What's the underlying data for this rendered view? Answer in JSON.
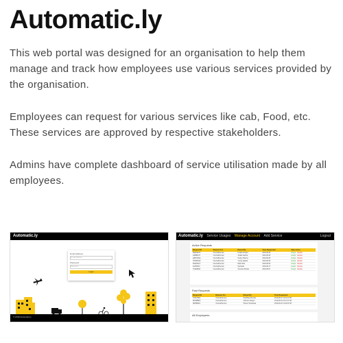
{
  "title": "Automatic.ly",
  "paragraphs": [
    "This web portal was designed for an organisation to help them manage and track how employees use various services provided by the organisation.",
    "Employees can request for various services like cab, Food, etc. These services are approved by respective stakeholders.",
    "Admins have complete dashboard of service utilisation made by all employees."
  ],
  "thumb_login": {
    "brand": "Automatic.ly",
    "email_label": "Email address",
    "email_placeholder": "E-mail address",
    "password_label": "Password",
    "password_placeholder": "Password",
    "login_button": "Login",
    "footer_text": "© 2018 Automatic.ly",
    "colors": {
      "accent": "#f5c518",
      "bar": "#000000"
    }
  },
  "thumb_dashboard": {
    "brand": "Automatic.ly",
    "nav": [
      "Service Usages",
      "Manage Account",
      "Add Service"
    ],
    "logout": "Logout",
    "active_requests_title": "Active Requests",
    "past_requests_title": "Past Requests",
    "all_employees_title": "All Employees",
    "active_headers": [
      "Request ID",
      "Request For",
      "Raised By",
      "Time Requested",
      "Take action"
    ],
    "active_rows": [
      [
        "3B2D4E7F",
        "OneCabService",
        "Krutika Prasad",
        "2019-08-26",
        "Accept",
        "Decline"
      ],
      [
        "a45B0C7F",
        "OneCabService",
        "Jinaba Kantha",
        "2019-08-26",
        "Accept",
        "Decline"
      ],
      [
        "a2BCD7Ea",
        "OneCabService",
        "Sudoy Sharma",
        "2019-08-05",
        "Accept",
        "Decline"
      ],
      [
        "7D29FE1E",
        "OneCabService",
        "Yuvraj Jaiswal",
        "2019-08-05",
        "Accept",
        "Decline"
      ],
      [
        "5DA8F0e3",
        "OneCabService",
        "Rahul Das",
        "2019-08-05",
        "Accept",
        "Decline"
      ],
      [
        "42A6F8c0",
        "OneCabService",
        "Sai Datta",
        "2019-08-17",
        "Accept",
        "Decline"
      ],
      [
        "7C4E8F8d",
        "OneCabService",
        "Virendra Shukla",
        "2019-08-07",
        "Accept",
        "Decline"
      ]
    ],
    "past_headers": [
      "Request ID",
      "Request For",
      "Raised By",
      "Time Requested"
    ],
    "past_rows": [
      [
        "7C5A79D4",
        "OneCabService",
        "Parthibaa Khenka",
        "2019-08-07 14:01:24 IST"
      ],
      [
        "5E7B8BF8",
        "OneCabService",
        "Abhinav Sangen",
        "2019-08-04 10:47:42 IST"
      ],
      [
        "3B45B2D1",
        "OneCabService",
        "Shinier Srivastava",
        "2019-09-22 11:09:33 IST"
      ]
    ],
    "colors": {
      "accent": "#f5c518",
      "accept": "#2a9d2a",
      "decline": "#d62828"
    }
  }
}
